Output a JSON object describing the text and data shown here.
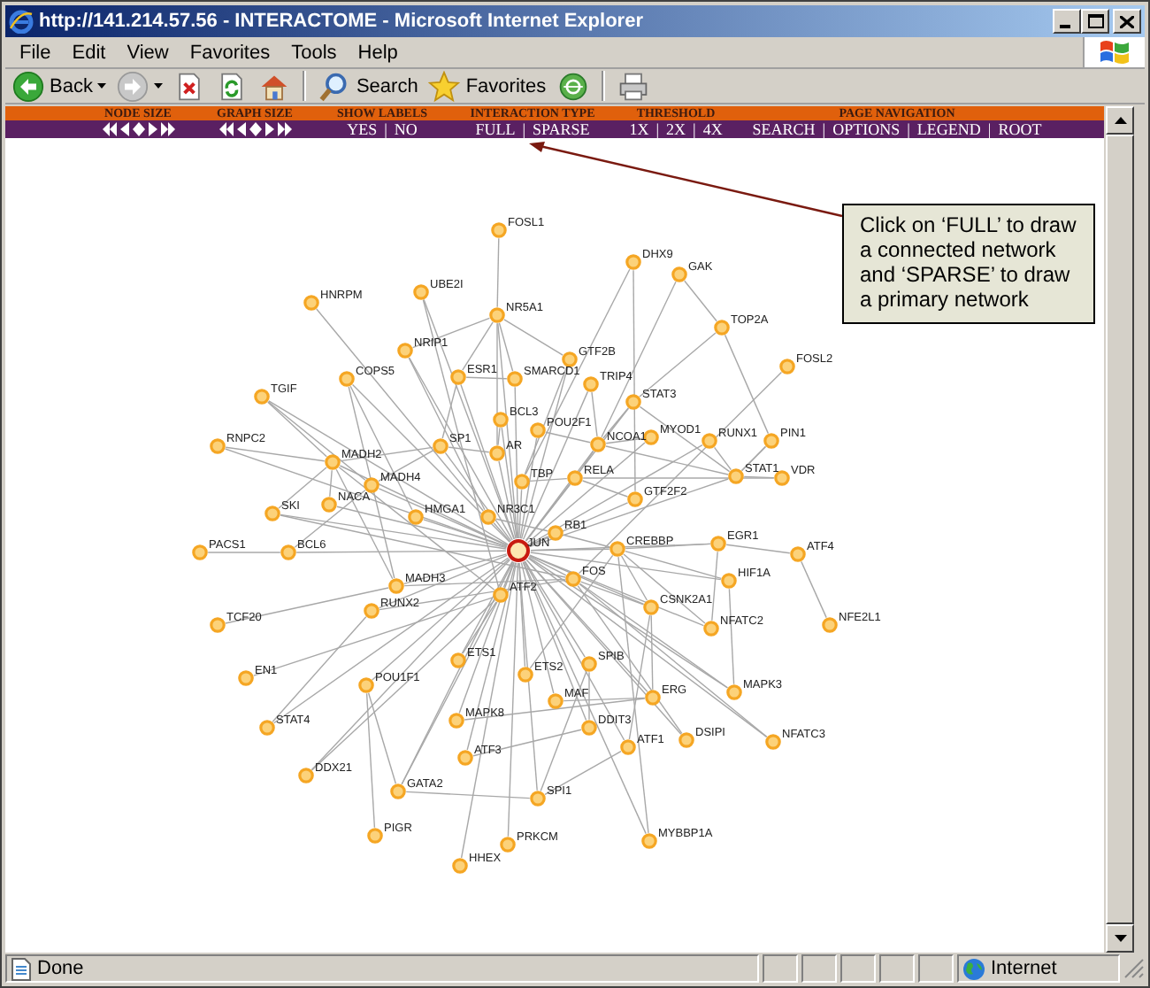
{
  "window": {
    "title": "http://141.214.57.56 - INTERACTOME - Microsoft Internet Explorer"
  },
  "menu": [
    "File",
    "Edit",
    "View",
    "Favorites",
    "Tools",
    "Help"
  ],
  "toolbar": [
    {
      "kind": "back",
      "label": "Back"
    },
    {
      "kind": "forward"
    },
    {
      "kind": "stop"
    },
    {
      "kind": "refresh"
    },
    {
      "kind": "home"
    },
    {
      "kind": "separator"
    },
    {
      "kind": "search",
      "label": "Search"
    },
    {
      "kind": "favorites",
      "label": "Favorites"
    },
    {
      "kind": "media"
    },
    {
      "kind": "separator"
    },
    {
      "kind": "print"
    }
  ],
  "nav": {
    "separator": "|",
    "groups": [
      {
        "title": "NODE SIZE",
        "kind": "arrows"
      },
      {
        "title": "GRAPH SIZE",
        "kind": "arrows"
      },
      {
        "title": "SHOW LABELS",
        "kind": "links",
        "links": [
          "YES",
          "NO"
        ]
      },
      {
        "title": "INTERACTION TYPE",
        "kind": "links",
        "links": [
          "FULL",
          "SPARSE"
        ]
      },
      {
        "title": "THRESHOLD",
        "kind": "links",
        "links": [
          "1X",
          "2X",
          "4X"
        ]
      },
      {
        "title": "PAGE NAVIGATION",
        "kind": "links",
        "links": [
          "SEARCH",
          "OPTIONS",
          "LEGEND",
          "ROOT"
        ]
      }
    ]
  },
  "graph": {
    "nodes": [
      {
        "label": "FOSL1",
        "kind": "gene"
      },
      {
        "label": "HNRPM",
        "kind": "gene"
      },
      {
        "label": "UBE2I",
        "kind": "gene"
      },
      {
        "label": "NR5A1",
        "kind": "gene"
      },
      {
        "label": "NRIP1",
        "kind": "gene"
      },
      {
        "label": "COPS5",
        "kind": "gene"
      },
      {
        "label": "ESR1",
        "kind": "gene"
      },
      {
        "label": "SMARCD1",
        "kind": "gene"
      },
      {
        "label": "GTF2B",
        "kind": "gene"
      },
      {
        "label": "TRIP4",
        "kind": "gene"
      },
      {
        "label": "TGIF",
        "kind": "gene"
      },
      {
        "label": "BCL3",
        "kind": "gene"
      },
      {
        "label": "POU2F1",
        "kind": "gene"
      },
      {
        "label": "RNPC2",
        "kind": "gene"
      },
      {
        "label": "SP1",
        "kind": "gene"
      },
      {
        "label": "AR",
        "kind": "gene"
      },
      {
        "label": "NCOA1",
        "kind": "gene"
      },
      {
        "label": "MADH2",
        "kind": "gene"
      },
      {
        "label": "MADH4",
        "kind": "gene"
      },
      {
        "label": "TBP",
        "kind": "gene"
      },
      {
        "label": "RELA",
        "kind": "gene"
      },
      {
        "label": "SKI",
        "kind": "gene"
      },
      {
        "label": "NACA",
        "kind": "gene"
      },
      {
        "label": "HMGA1",
        "kind": "gene"
      },
      {
        "label": "NR3C1",
        "kind": "gene"
      },
      {
        "label": "RB1",
        "kind": "gene"
      },
      {
        "label": "PACS1",
        "kind": "gene"
      },
      {
        "label": "BCL6",
        "kind": "gene"
      },
      {
        "label": "JUN",
        "kind": "hub"
      },
      {
        "label": "DHX9",
        "kind": "gene"
      },
      {
        "label": "GAK",
        "kind": "gene"
      },
      {
        "label": "TOP2A",
        "kind": "gene"
      },
      {
        "label": "FOSL2",
        "kind": "gene"
      },
      {
        "label": "STAT3",
        "kind": "gene"
      },
      {
        "label": "MYOD1",
        "kind": "gene"
      },
      {
        "label": "RUNX1",
        "kind": "gene"
      },
      {
        "label": "PIN1",
        "kind": "gene"
      },
      {
        "label": "STAT1",
        "kind": "gene"
      },
      {
        "label": "VDR",
        "kind": "gene"
      },
      {
        "label": "GTF2F2",
        "kind": "gene"
      },
      {
        "label": "CREBBP",
        "kind": "gene"
      },
      {
        "label": "EGR1",
        "kind": "gene"
      },
      {
        "label": "ATF4",
        "kind": "gene"
      },
      {
        "label": "HIF1A",
        "kind": "gene"
      },
      {
        "label": "MADH3",
        "kind": "gene"
      },
      {
        "label": "ATF2",
        "kind": "gene"
      },
      {
        "label": "FOS",
        "kind": "gene"
      },
      {
        "label": "RUNX2",
        "kind": "gene"
      },
      {
        "label": "TCF20",
        "kind": "gene"
      },
      {
        "label": "ETS1",
        "kind": "gene"
      },
      {
        "label": "ETS2",
        "kind": "gene"
      },
      {
        "label": "SPIB",
        "kind": "gene"
      },
      {
        "label": "EN1",
        "kind": "gene"
      },
      {
        "label": "POU1F1",
        "kind": "gene"
      },
      {
        "label": "MAF",
        "kind": "gene"
      },
      {
        "label": "MAPK8",
        "kind": "gene"
      },
      {
        "label": "DDIT3",
        "kind": "gene"
      },
      {
        "label": "STAT4",
        "kind": "gene"
      },
      {
        "label": "ATF3",
        "kind": "gene"
      },
      {
        "label": "DDX21",
        "kind": "gene"
      },
      {
        "label": "GATA2",
        "kind": "gene"
      },
      {
        "label": "SPI1",
        "kind": "gene"
      },
      {
        "label": "PIGR",
        "kind": "gene"
      },
      {
        "label": "PRKCM",
        "kind": "gene"
      },
      {
        "label": "HHEX",
        "kind": "gene"
      },
      {
        "label": "CSNK2A1",
        "kind": "gene"
      },
      {
        "label": "NFATC2",
        "kind": "gene"
      },
      {
        "label": "NFE2L1",
        "kind": "gene"
      },
      {
        "label": "ERG",
        "kind": "gene"
      },
      {
        "label": "MAPK3",
        "kind": "gene"
      },
      {
        "label": "ATF1",
        "kind": "gene"
      },
      {
        "label": "DSIPI",
        "kind": "gene"
      },
      {
        "label": "NFATC3",
        "kind": "gene"
      },
      {
        "label": "MYBBP1A",
        "kind": "gene"
      }
    ]
  },
  "callout": {
    "text": "Click on ‘FULL’ to draw a connected network and ‘SPARSE’ to draw a primary network"
  },
  "status_bar": {
    "text": "Done",
    "zone": "Internet"
  }
}
